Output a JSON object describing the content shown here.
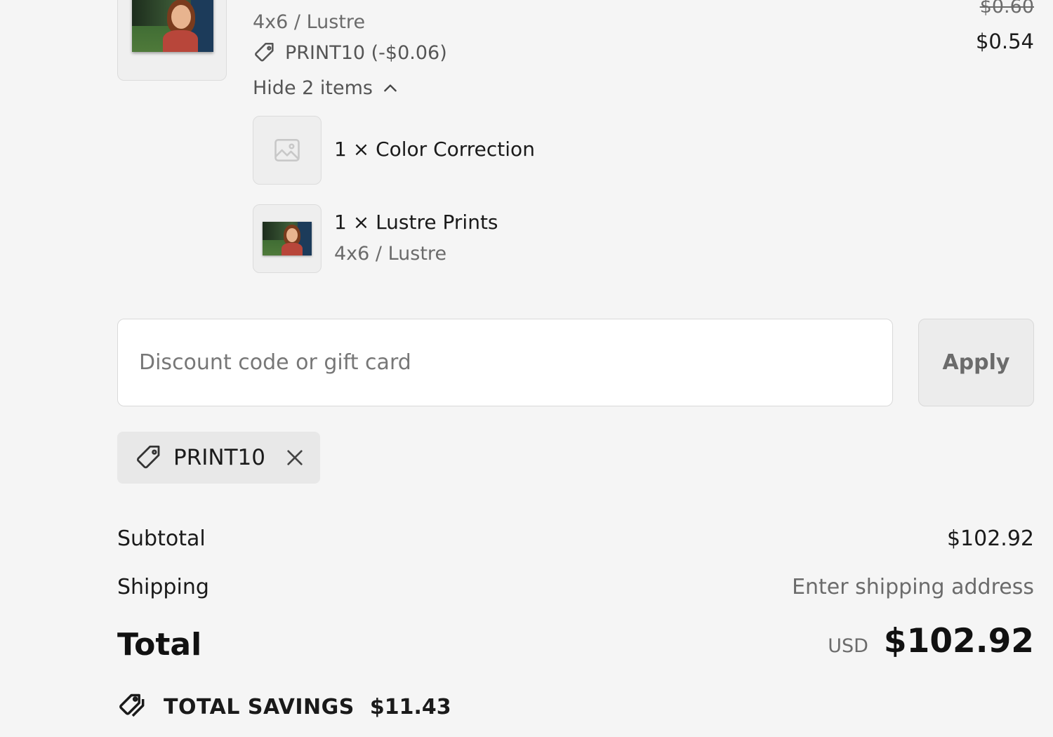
{
  "line_item": {
    "variant": "4x6 / Lustre",
    "original_price": "$0.60",
    "price": "$0.54",
    "discount_line": "PRINT10 (-$0.06)",
    "toggle_label": "Hide 2 items"
  },
  "bundle_items": [
    {
      "title": "1 × Color Correction"
    },
    {
      "title": "1 × Lustre Prints",
      "variant": "4x6 / Lustre"
    }
  ],
  "discount_form": {
    "placeholder": "Discount code or gift card",
    "apply_label": "Apply"
  },
  "applied_code": {
    "code": "PRINT10"
  },
  "summary": {
    "subtotal_label": "Subtotal",
    "subtotal_value": "$102.92",
    "shipping_label": "Shipping",
    "shipping_value": "Enter shipping address",
    "total_label": "Total",
    "currency": "USD",
    "total_value": "$102.92",
    "savings_label": "TOTAL SAVINGS",
    "savings_value": "$11.43"
  },
  "icons": {
    "tag": "tag-icon",
    "chevron": "chevron-up-icon",
    "close": "close-icon",
    "placeholder_image": "image-placeholder-icon",
    "savings_tags": "tags-icon"
  }
}
